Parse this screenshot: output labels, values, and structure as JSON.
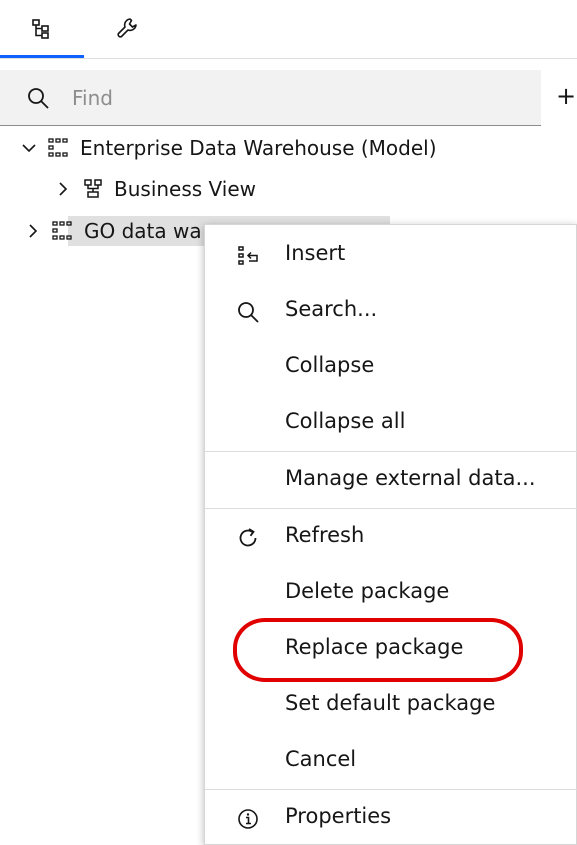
{
  "tabs": [
    {
      "icon": "hierarchy-icon",
      "active": true
    },
    {
      "icon": "wrench-icon",
      "active": false
    }
  ],
  "search": {
    "placeholder": "Find",
    "value": ""
  },
  "toolbar": {
    "add_label": "+"
  },
  "tree": [
    {
      "label": "Enterprise Data Warehouse (Model)",
      "expanded": true,
      "icon": "data-module-icon"
    },
    {
      "label": "Business View",
      "expanded": false,
      "icon": "hierarchy-icon"
    },
    {
      "label": "GO data wa",
      "expanded": false,
      "icon": "data-module-icon"
    }
  ],
  "context_menu": {
    "items": [
      {
        "label": "Insert",
        "icon": "insert-icon"
      },
      {
        "label": "Search...",
        "icon": "search-icon"
      },
      {
        "label": "Collapse"
      },
      {
        "label": "Collapse all"
      },
      {
        "label": "Manage external data..."
      },
      {
        "label": "Refresh",
        "icon": "refresh-icon"
      },
      {
        "label": "Delete package"
      },
      {
        "label": "Replace package",
        "circled": true
      },
      {
        "label": "Set default package"
      },
      {
        "label": "Cancel"
      },
      {
        "label": "Properties",
        "icon": "info-icon"
      }
    ]
  },
  "colors": {
    "accent": "#0f62fe",
    "annotation": "#e00000",
    "selected_row": "#e0e0e0"
  }
}
